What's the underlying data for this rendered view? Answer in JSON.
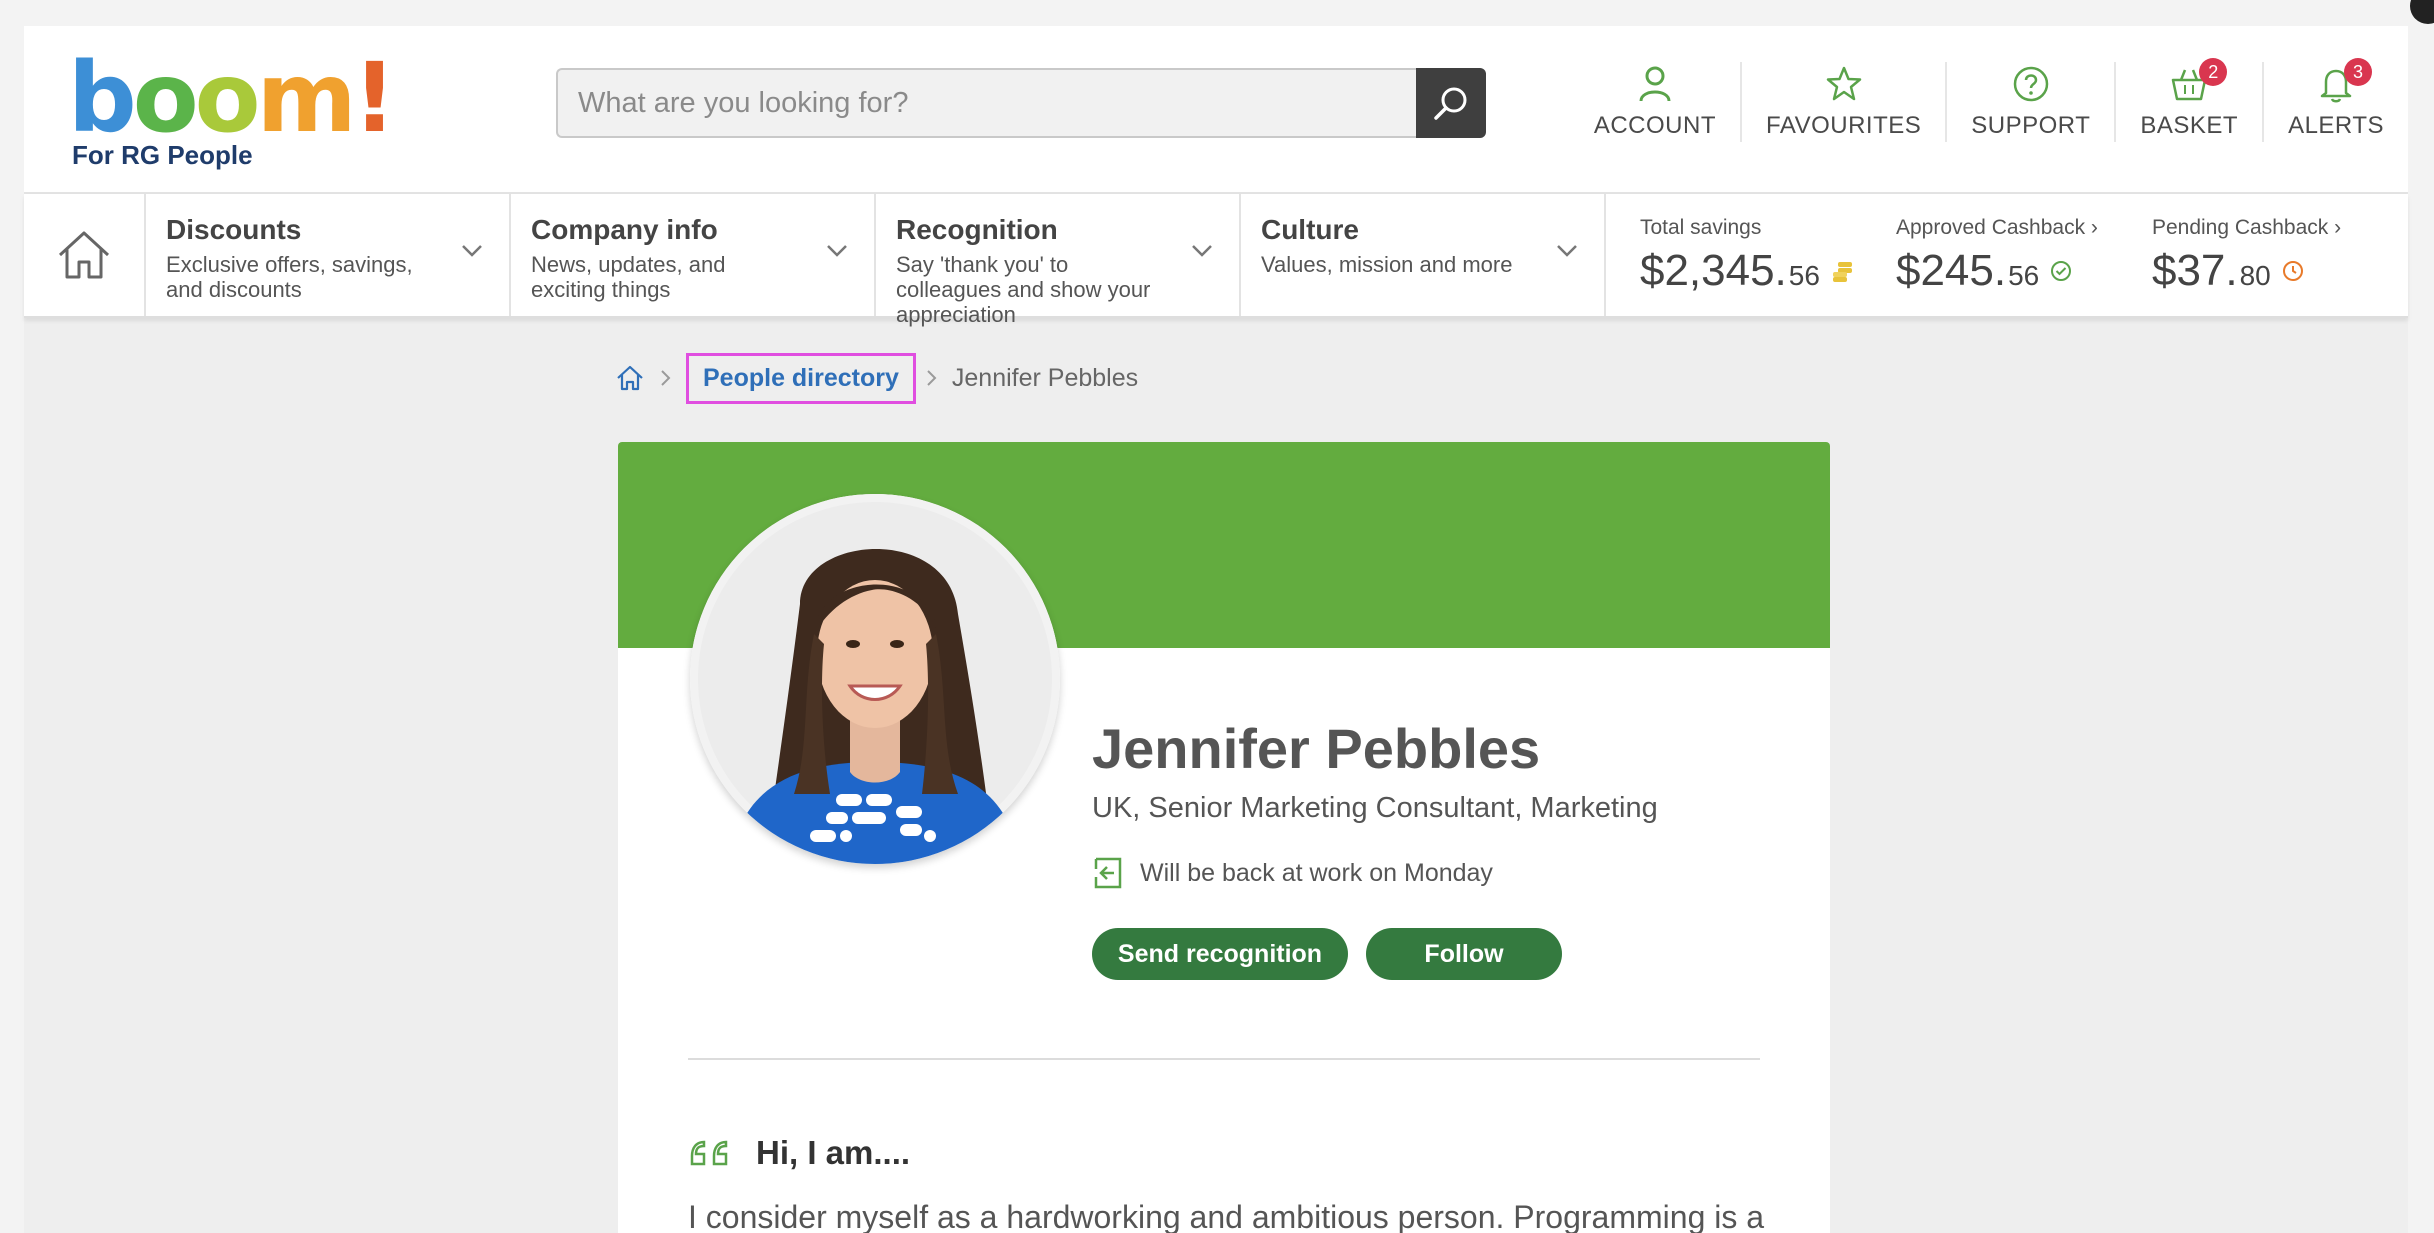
{
  "header": {
    "logo_text": "boom!",
    "logo_subtitle": "For RG People",
    "search": {
      "placeholder": "What are you looking for?"
    },
    "nav": [
      {
        "label": "ACCOUNT",
        "icon": "user-icon"
      },
      {
        "label": "FAVOURITES",
        "icon": "star-icon"
      },
      {
        "label": "SUPPORT",
        "icon": "help-icon"
      },
      {
        "label": "BASKET",
        "icon": "basket-icon",
        "badge": "2"
      },
      {
        "label": "ALERTS",
        "icon": "bell-icon",
        "badge": "3"
      }
    ]
  },
  "navbar": {
    "categories": [
      {
        "title": "Discounts",
        "desc": "Exclusive offers, savings, and discounts"
      },
      {
        "title": "Company info",
        "desc": "News, updates, and exciting things"
      },
      {
        "title": "Recognition",
        "desc": "Say 'thank you' to colleagues and show your appreciation"
      },
      {
        "title": "Culture",
        "desc": "Values, mission and more"
      }
    ],
    "savings": [
      {
        "label": "Total savings",
        "dollars": "$2,345.",
        "cents": "56"
      },
      {
        "label": "Approved Cashback ›",
        "dollars": "$245.",
        "cents": "56"
      },
      {
        "label": "Pending Cashback ›",
        "dollars": "$37.",
        "cents": "80"
      }
    ]
  },
  "breadcrumb": {
    "link": "People directory",
    "current": "Jennifer Pebbles"
  },
  "profile": {
    "name": "Jennifer Pebbles",
    "role": "UK, Senior Marketing Consultant, Marketing",
    "status": "Will be back at work on Monday",
    "send_label": "Send recognition",
    "follow_label": "Follow",
    "about_title": "Hi, I am....",
    "about_text": "I consider myself as a hardworking and ambitious person. Programming is a major part of my life, and so I spend most of the day reading"
  },
  "colors": {
    "brand_green": "#63ac3f",
    "button_green": "#347a3f",
    "link_blue": "#2f6fb8",
    "badge_red": "#d9364f"
  }
}
